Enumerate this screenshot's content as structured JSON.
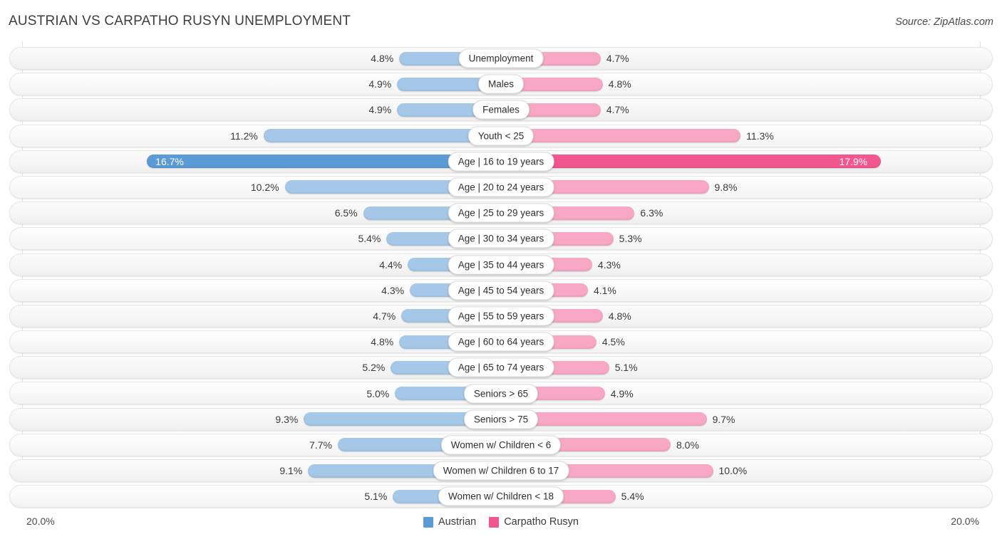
{
  "header": {
    "title": "AUSTRIAN VS CARPATHO RUSYN UNEMPLOYMENT",
    "source": "Source: ZipAtlas.com"
  },
  "axis": {
    "left_label": "20.0%",
    "right_label": "20.0%",
    "max": 20.0
  },
  "legend": {
    "items": [
      {
        "label": "Austrian",
        "color": "#5B9BD5"
      },
      {
        "label": "Carpatho Rusyn",
        "color": "#F2568F"
      }
    ]
  },
  "colors": {
    "austrian_light": "#A6C8E8",
    "austrian_dark": "#5B9BD5",
    "rusyn_light": "#F8A8C4",
    "rusyn_dark": "#F2568F"
  },
  "chart_data": {
    "type": "bar",
    "title": "AUSTRIAN VS CARPATHO RUSYN UNEMPLOYMENT",
    "subtitle": "",
    "xlabel": "",
    "ylabel": "",
    "orientation": "horizontal-diverging",
    "xlim": [
      20.0,
      20.0
    ],
    "grid": true,
    "legend_position": "bottom-center",
    "categories": [
      "Unemployment",
      "Males",
      "Females",
      "Youth < 25",
      "Age | 16 to 19 years",
      "Age | 20 to 24 years",
      "Age | 25 to 29 years",
      "Age | 30 to 34 years",
      "Age | 35 to 44 years",
      "Age | 45 to 54 years",
      "Age | 55 to 59 years",
      "Age | 60 to 64 years",
      "Age | 65 to 74 years",
      "Seniors > 65",
      "Seniors > 75",
      "Women w/ Children < 6",
      "Women w/ Children 6 to 17",
      "Women w/ Children < 18"
    ],
    "series": [
      {
        "name": "Austrian",
        "color": "#A6C8E8",
        "values": [
          4.8,
          4.9,
          4.9,
          11.2,
          16.7,
          10.2,
          6.5,
          5.4,
          4.4,
          4.3,
          4.7,
          4.8,
          5.2,
          5.0,
          9.3,
          7.7,
          9.1,
          5.1
        ],
        "labels": [
          "4.8%",
          "4.9%",
          "4.9%",
          "11.2%",
          "16.7%",
          "10.2%",
          "6.5%",
          "5.4%",
          "4.4%",
          "4.3%",
          "4.7%",
          "4.8%",
          "5.2%",
          "5.0%",
          "9.3%",
          "7.7%",
          "9.1%",
          "5.1%"
        ]
      },
      {
        "name": "Carpatho Rusyn",
        "color": "#F8A8C4",
        "values": [
          4.7,
          4.8,
          4.7,
          11.3,
          17.9,
          9.8,
          6.3,
          5.3,
          4.3,
          4.1,
          4.8,
          4.5,
          5.1,
          4.9,
          9.7,
          8.0,
          10.0,
          5.4
        ],
        "labels": [
          "4.7%",
          "4.8%",
          "4.7%",
          "11.3%",
          "17.9%",
          "9.8%",
          "6.3%",
          "5.3%",
          "4.3%",
          "4.1%",
          "4.8%",
          "4.5%",
          "5.1%",
          "4.9%",
          "9.7%",
          "8.0%",
          "10.0%",
          "5.4%"
        ]
      }
    ],
    "highlight_row_index": 4
  }
}
